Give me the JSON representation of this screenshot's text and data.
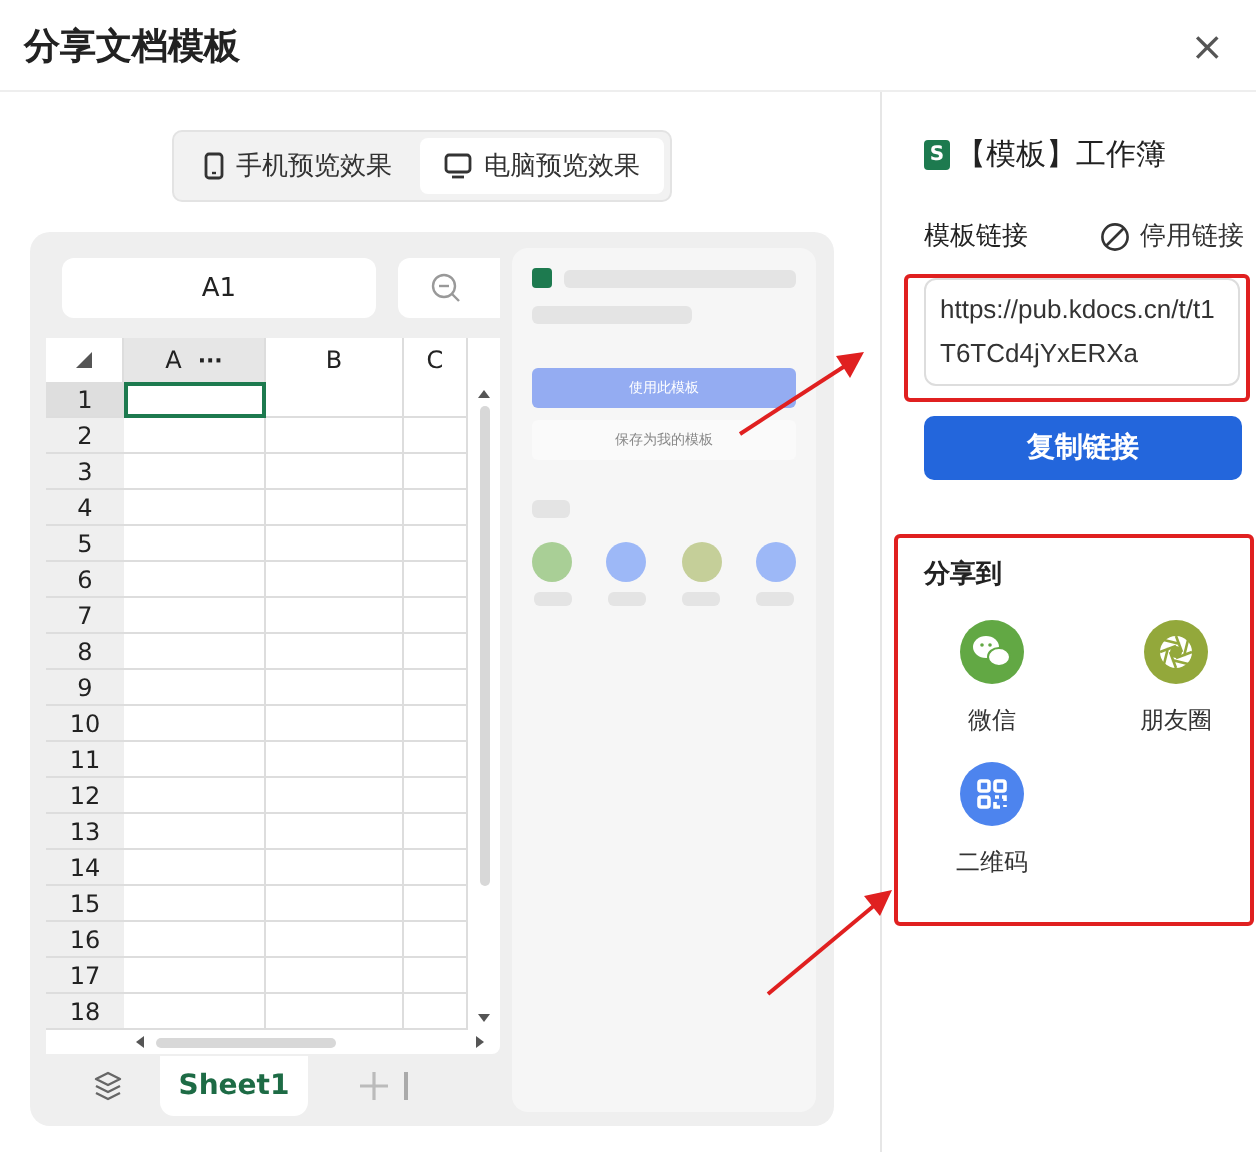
{
  "window": {
    "title": "分享文档模板",
    "close": "×"
  },
  "view_tabs": [
    {
      "label": "手机预览效果",
      "kind": "phone",
      "selected": false
    },
    {
      "label": "电脑预览效果",
      "kind": "desktop",
      "selected": true
    }
  ],
  "sheet": {
    "name_box": "A1",
    "columns": [
      "A",
      "B",
      "C"
    ],
    "more": "···",
    "rows": [
      "1",
      "2",
      "3",
      "4",
      "5",
      "6",
      "7",
      "8",
      "9",
      "10",
      "11",
      "12",
      "13",
      "14",
      "15",
      "16",
      "17",
      "18"
    ],
    "sheet_tab": "Sheet1"
  },
  "mobile_preview": {
    "use_button": "使用此模板",
    "save_button": "保存为我的模板",
    "share_targets": [
      {
        "color": "#a9cf96"
      },
      {
        "color": "#9db8f7"
      },
      {
        "color": "#c5cf99"
      },
      {
        "color": "#9db8f7"
      }
    ]
  },
  "doc": {
    "badge": "S",
    "title": "【模板】工作簿"
  },
  "link": {
    "label": "模板链接",
    "disable": "停用链接",
    "url": "https://pub.kdocs.cn/t/t1T6TCd4jYxERXa",
    "copy_button": "复制链接"
  },
  "share": {
    "title": "分享到",
    "targets": [
      {
        "label": "微信",
        "kind": "wechat",
        "color": "#62a844"
      },
      {
        "label": "朋友圈",
        "kind": "moments",
        "color": "#93a83b"
      },
      {
        "label": "二维码",
        "kind": "qrcode",
        "color": "#4d84ee"
      }
    ]
  }
}
